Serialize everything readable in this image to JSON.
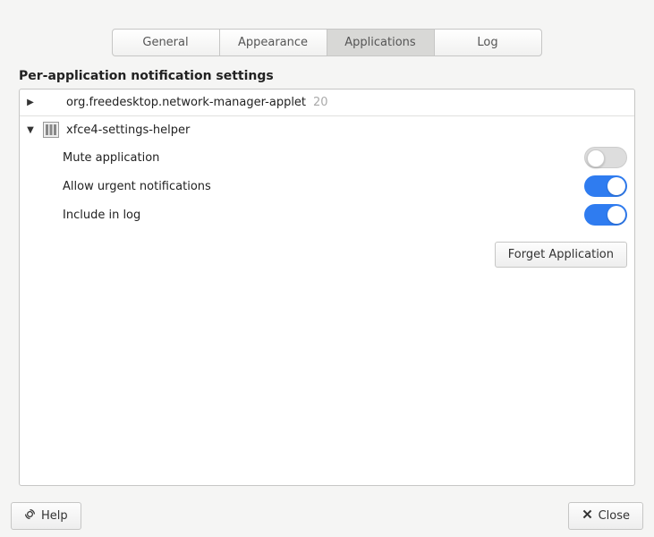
{
  "tabs": {
    "general": "General",
    "appearance": "Appearance",
    "applications": "Applications",
    "log": "Log"
  },
  "section_title": "Per-application notification settings",
  "apps": [
    {
      "name": "org.freedesktop.network-manager-applet",
      "count": "20"
    },
    {
      "name": "xfce4-settings-helper"
    }
  ],
  "options": {
    "mute": {
      "label": "Mute application",
      "on": false
    },
    "urgent": {
      "label": "Allow urgent notifications",
      "on": true
    },
    "include_log": {
      "label": "Include in log",
      "on": true
    }
  },
  "buttons": {
    "forget": "Forget Application",
    "help": "Help",
    "close": "Close"
  }
}
